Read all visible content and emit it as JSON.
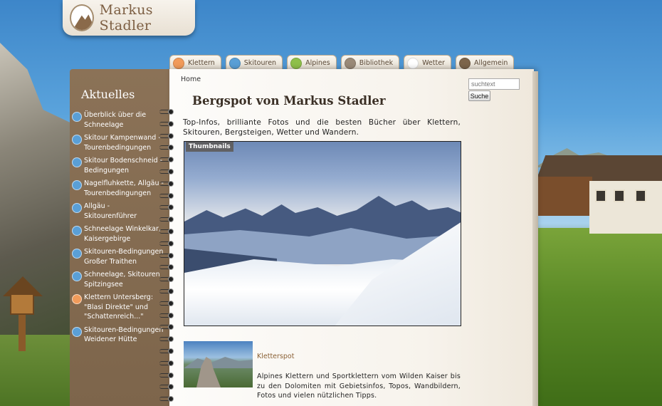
{
  "logo": {
    "text": "Markus Stadler"
  },
  "nav": {
    "tabs": [
      {
        "label": "Klettern",
        "icon": "climbing-icon",
        "color": "#f29b5a"
      },
      {
        "label": "Skitouren",
        "icon": "skitour-icon",
        "color": "#5a9fd6"
      },
      {
        "label": "Alpines",
        "icon": "alpine-icon",
        "color": "#8fc04a"
      },
      {
        "label": "Bibliothek",
        "icon": "library-icon",
        "color": "#9a8a78"
      },
      {
        "label": "Wetter",
        "icon": "weather-icon",
        "color": "#ffffff"
      },
      {
        "label": "Allgemein",
        "icon": "general-icon",
        "color": "#7d654b"
      }
    ]
  },
  "sidebar": {
    "title": "Aktuelles",
    "items": [
      {
        "label": "Überblick über die Schneelage",
        "icon": "skitour-icon",
        "color": "#5a9fd6"
      },
      {
        "label": "Skitour Kampenwand - Tourenbedingungen",
        "icon": "skitour-icon",
        "color": "#5a9fd6"
      },
      {
        "label": "Skitour Bodenschneid - Bedingungen",
        "icon": "skitour-icon",
        "color": "#5a9fd6"
      },
      {
        "label": "Nagelfluhkette, Allgäu - Tourenbedingungen",
        "icon": "skitour-icon",
        "color": "#5a9fd6"
      },
      {
        "label": "Allgäu - Skitourenführer",
        "icon": "skitour-icon",
        "color": "#5a9fd6"
      },
      {
        "label": "Schneelage Winkelkar, Kaisergebirge",
        "icon": "skitour-icon",
        "color": "#5a9fd6"
      },
      {
        "label": "Skitouren-Bedingungen Großer Traithen",
        "icon": "skitour-icon",
        "color": "#5a9fd6"
      },
      {
        "label": "Schneelage, Skitouren Spitzingsee",
        "icon": "skitour-icon",
        "color": "#5a9fd6"
      },
      {
        "label": "Klettern Untersberg: \"Blasi Direkte\" und \"Schattenreich...\"",
        "icon": "climbing-icon",
        "color": "#f29b5a"
      },
      {
        "label": "Skitouren-Bedingungen Weidener Hütte",
        "icon": "skitour-icon",
        "color": "#5a9fd6"
      }
    ]
  },
  "breadcrumb": "Home",
  "search": {
    "placeholder": "suchtext",
    "button": "Suche"
  },
  "main": {
    "title": "Bergspot von Markus Stadler",
    "intro": "Top-Infos, brilliante Fotos und die besten Bücher über Klettern, Skitouren, Bergsteigen, Wetter und Wandern.",
    "hero_tag": "Thumbnails",
    "teaser": {
      "title": "Kletterspot",
      "text": "Alpines Klettern und Sportklettern vom Wilden Kaiser bis zu den Dolomiten mit Gebietsinfos, Topos, Wandbildern, Fotos und vielen nützlichen Tipps."
    }
  }
}
